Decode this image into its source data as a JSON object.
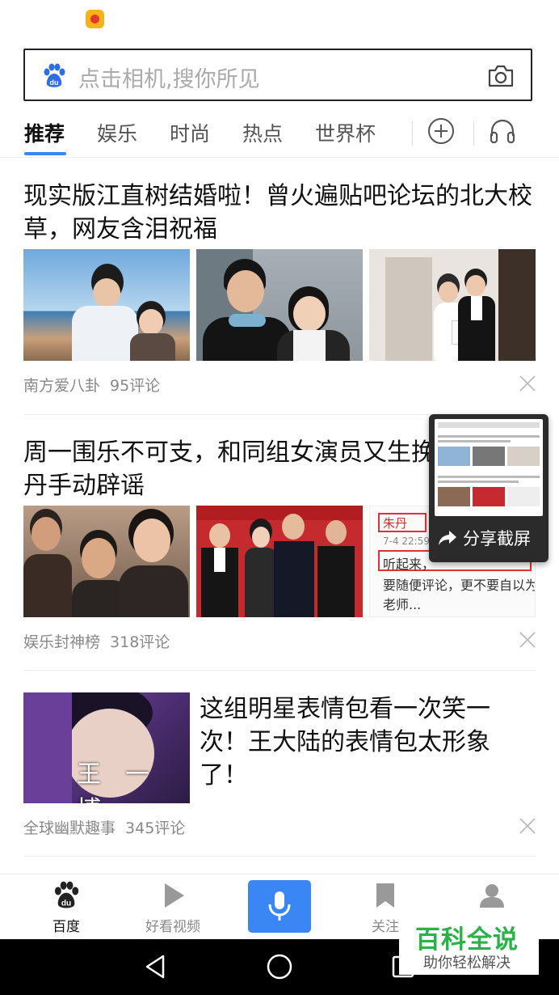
{
  "search": {
    "placeholder": "点击相机,搜你所见"
  },
  "tabs": [
    {
      "label": "推荐"
    },
    {
      "label": "娱乐"
    },
    {
      "label": "时尚"
    },
    {
      "label": "热点"
    },
    {
      "label": "世界杯"
    }
  ],
  "feed": [
    {
      "title": "现实版江直树结婚啦！曾火遍贴吧论坛的北大校草，网友含泪祝福",
      "source": "南方爱八卦",
      "comments": "95评论"
    },
    {
      "title": "周一围乐不可支，和同组女演员又生挽手臂，朱丹手动辟谣",
      "source": "娱乐封神榜",
      "comments": "318评论"
    },
    {
      "title": "这组明星表情包看一次笑一次！王大陆的表情包太形象了！",
      "source": "全球幽默趣事",
      "comments": "345评论"
    }
  ],
  "thumb_text": {
    "wang": "王一博",
    "zhudan_name": "朱丹",
    "zhudan_time": "7-4 22:59",
    "zhudan_line1": "听起来，",
    "zhudan_line2": "要随便评论，更不要自以为",
    "zhudan_line3": "老师..."
  },
  "screenshot_popup": {
    "label": "分享截屏"
  },
  "bottom_nav": [
    {
      "label": "百度"
    },
    {
      "label": "好看视频"
    },
    {
      "label": "关注"
    }
  ],
  "watermark": {
    "title": "百科全说",
    "subtitle": "助你轻松解决"
  },
  "colors": {
    "accent": "#3a86f5",
    "watermark_green": "#2bb14a"
  }
}
